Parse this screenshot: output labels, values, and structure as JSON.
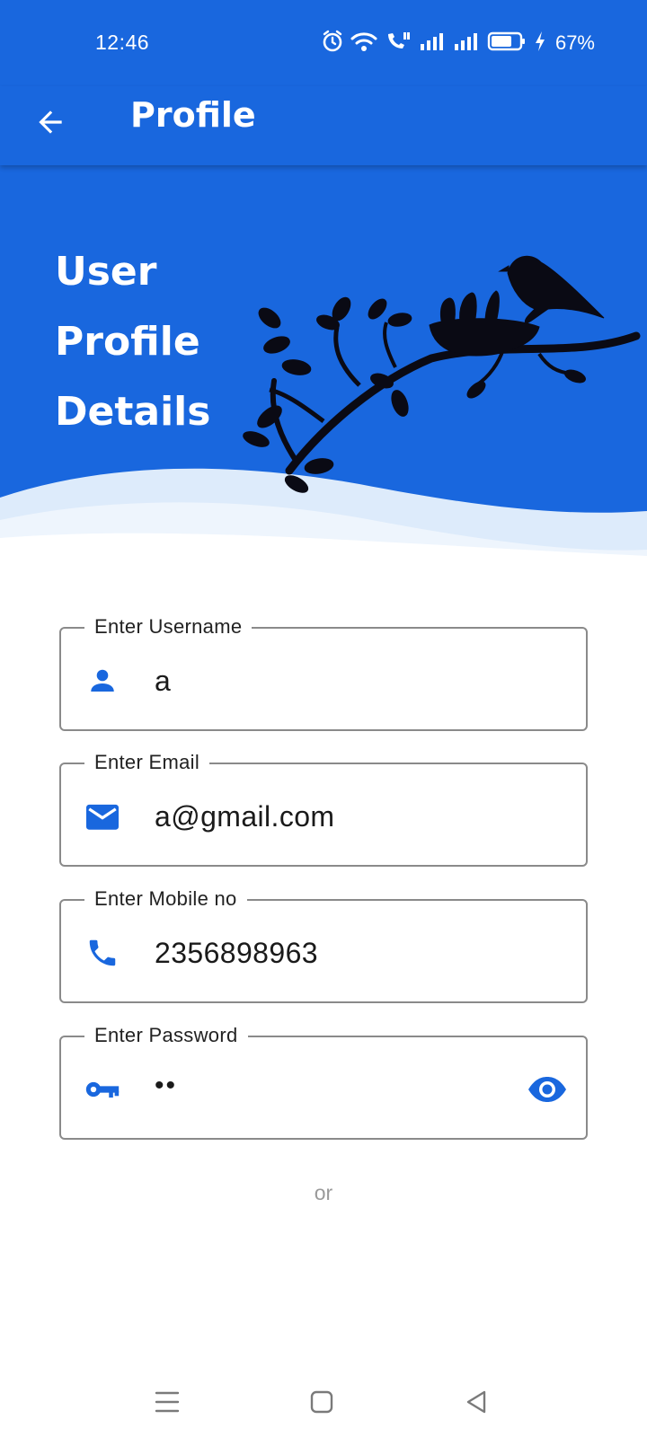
{
  "status_bar": {
    "time": "12:46",
    "battery_percent": "67%",
    "icons": [
      "alarm-icon",
      "wifi-icon",
      "wifi-calling-icon",
      "signal-icon",
      "signal-icon",
      "battery-icon",
      "charging-icon"
    ]
  },
  "app_bar": {
    "title": "Profile",
    "back_icon": "arrow-back-icon"
  },
  "hero": {
    "title_lines": [
      "User",
      "Profile",
      "Details"
    ],
    "illustration": "bird-nest-branch-silhouette"
  },
  "form": {
    "username": {
      "label": "Enter Username",
      "value": "a",
      "icon": "person-icon"
    },
    "email": {
      "label": "Enter Email",
      "value": "a@gmail.com",
      "icon": "email-icon"
    },
    "mobile": {
      "label": "Enter Mobile no",
      "value": "2356898963",
      "icon": "phone-icon"
    },
    "password": {
      "label": "Enter Password",
      "value": "••",
      "icon": "key-icon",
      "toggle_icon": "eye-icon"
    },
    "or_text": "or"
  },
  "nav_bar": {
    "items": [
      "menu-icon",
      "home-icon",
      "back-icon"
    ]
  },
  "colors": {
    "primary": "#1967DE",
    "wave_light": "#DDEBFB",
    "wave_lighter": "#EEF5FD",
    "outline": "#8A8A8A",
    "muted_text": "#9A9A9A"
  }
}
